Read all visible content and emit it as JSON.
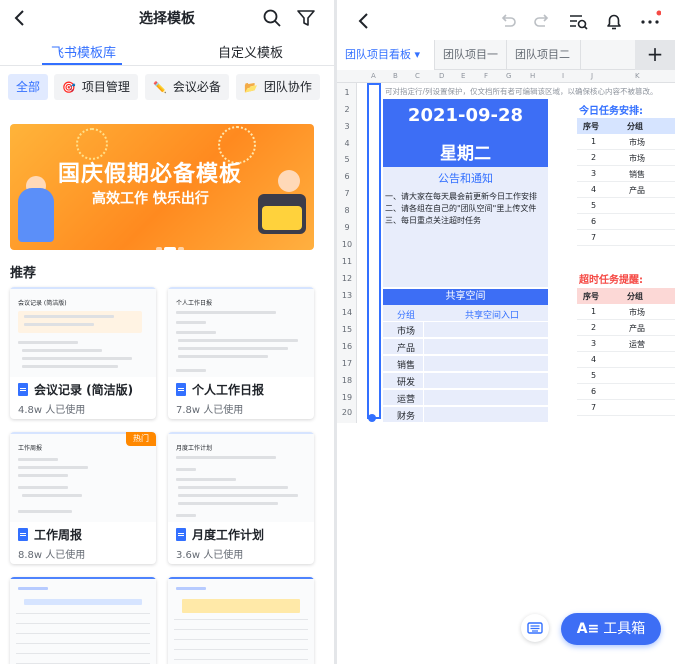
{
  "left": {
    "header": {
      "title": "选择模板"
    },
    "tabs": [
      {
        "label": "飞书模板库"
      },
      {
        "label": "自定义模板"
      }
    ],
    "chips": [
      {
        "label": "全部"
      },
      {
        "label": "项目管理"
      },
      {
        "label": "会议必备"
      },
      {
        "label": "团队协作"
      }
    ],
    "banner": {
      "title": "国庆假期必备模板",
      "subtitle": "高效工作 快乐出行"
    },
    "section_title": "推荐",
    "cards": [
      {
        "title": "会议记录 (简洁版)",
        "usage": "4.8w 人已使用",
        "thumb_title": "会议记录 (简洁版)",
        "hot": ""
      },
      {
        "title": "个人工作日报",
        "usage": "7.8w 人已使用",
        "thumb_title": "个人工作日报",
        "hot": ""
      },
      {
        "title": "工作周报",
        "usage": "8.8w 人已使用",
        "thumb_title": "工作周报",
        "hot": "热门"
      },
      {
        "title": "月度工作计划",
        "usage": "3.6w 人已使用",
        "thumb_title": "月度工作计划",
        "hot": ""
      }
    ]
  },
  "right": {
    "tabs": [
      {
        "label": "团队项目看板 ▾"
      },
      {
        "label": "团队项目一"
      },
      {
        "label": "团队项目二"
      }
    ],
    "add_label": "+",
    "columns": [
      "A",
      "B",
      "C",
      "D",
      "E",
      "F",
      "G",
      "H",
      "I",
      "J",
      "K"
    ],
    "rows": [
      "1",
      "2",
      "3",
      "4",
      "5",
      "6",
      "7",
      "8",
      "9",
      "10",
      "11",
      "12",
      "13",
      "14",
      "15",
      "16",
      "17",
      "18",
      "19",
      "20"
    ],
    "notice_text": "可对指定行/列设置保护，仅文档所有者可编辑该区域，以确保核心内容不被篡改。",
    "date": "2021-09-28",
    "weekday": "星期二",
    "announce_title": "公告和通知",
    "announce_lines": [
      "一、请大家在每天晨会前更新今日工作安排",
      "二、请各组在自己的\"团队空间\"里上传文件",
      "三、每日重点关注超时任务"
    ],
    "share": {
      "title": "共享空间",
      "col1": "分组",
      "col2": "共享空间入口",
      "groups": [
        "市场",
        "产品",
        "销售",
        "研发",
        "运营",
        "财务"
      ]
    },
    "today": {
      "title": "今日任务安排:",
      "col1": "序号",
      "col2": "分组",
      "rows": [
        {
          "n": "1",
          "g": "市场"
        },
        {
          "n": "2",
          "g": "市场"
        },
        {
          "n": "3",
          "g": "销售"
        },
        {
          "n": "4",
          "g": "产品"
        },
        {
          "n": "5",
          "g": ""
        },
        {
          "n": "6",
          "g": ""
        },
        {
          "n": "7",
          "g": ""
        }
      ]
    },
    "overdue": {
      "title": "超时任务提醒:",
      "col1": "序号",
      "col2": "分组",
      "rows": [
        {
          "n": "1",
          "g": "市场"
        },
        {
          "n": "2",
          "g": "产品"
        },
        {
          "n": "3",
          "g": "运营"
        },
        {
          "n": "4",
          "g": ""
        },
        {
          "n": "5",
          "g": ""
        },
        {
          "n": "6",
          "g": ""
        },
        {
          "n": "7",
          "g": ""
        }
      ]
    },
    "toolbox_label": "工具箱"
  },
  "colors": {
    "accent": "#3370ff",
    "header_blue": "#3d6ef5",
    "overdue_red": "#f54a45",
    "banner_orange": "#ff8a1f"
  }
}
